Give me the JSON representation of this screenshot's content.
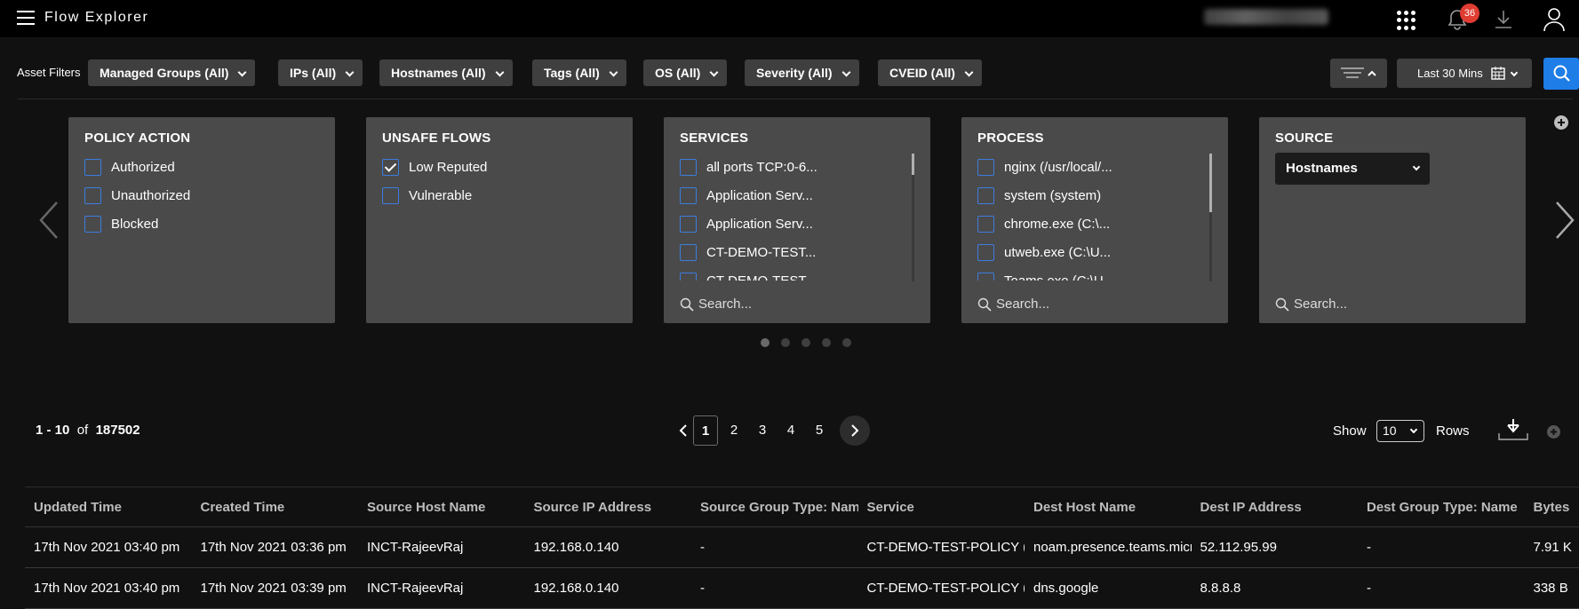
{
  "header": {
    "title": "Flow Explorer",
    "notification_count": "36",
    "icons": [
      "menu-icon",
      "apps-grid-icon",
      "bell-icon",
      "download-icon",
      "user-icon"
    ]
  },
  "filters": {
    "label": "Asset Filters",
    "chips": [
      "Managed Groups (All)",
      "IPs (All)",
      "Hostnames (All)",
      "Tags (All)",
      "OS (All)",
      "Severity (All)",
      "CVEID (All)"
    ],
    "time_range": "Last 30 Mins"
  },
  "cards": {
    "policy_action": {
      "title": "POLICY ACTION",
      "options": [
        {
          "label": "Authorized",
          "checked": false
        },
        {
          "label": "Unauthorized",
          "checked": false
        },
        {
          "label": "Blocked",
          "checked": false
        }
      ]
    },
    "unsafe_flows": {
      "title": "UNSAFE FLOWS",
      "options": [
        {
          "label": "Low Reputed",
          "checked": true
        },
        {
          "label": "Vulnerable",
          "checked": false
        }
      ]
    },
    "services": {
      "title": "SERVICES",
      "options": [
        "all ports TCP:0-6...",
        "Application Serv...",
        "Application Serv...",
        "CT-DEMO-TEST...",
        "CT-DEMO-TEST..."
      ],
      "search_placeholder": "Search..."
    },
    "process": {
      "title": "PROCESS",
      "options": [
        "nginx (/usr/local/...",
        "system (system)",
        "chrome.exe (C:\\...",
        "utweb.exe (C:\\U...",
        "Teams.exe (C:\\U..."
      ],
      "search_placeholder": "Search..."
    },
    "source": {
      "title": "SOURCE",
      "selected": "Hostnames",
      "search_placeholder": "Search..."
    }
  },
  "carousel": {
    "pages": 5,
    "active": 1
  },
  "pagination": {
    "range": "1 - 10",
    "of": "of",
    "total": "187502",
    "pages": [
      "1",
      "2",
      "3",
      "4",
      "5"
    ],
    "current": "1",
    "show_label": "Show",
    "rows_value": "10",
    "rows_label": "Rows"
  },
  "table": {
    "columns": [
      "Updated Time",
      "Created Time",
      "Source Host Name",
      "Source IP Address",
      "Source Group Type: Name",
      "Service",
      "Dest Host Name",
      "Dest IP Address",
      "Dest Group Type: Name",
      "Bytes"
    ],
    "rows": [
      [
        "17th Nov 2021 03:40 pm",
        "17th Nov 2021 03:36 pm",
        "INCT-RajeevRaj",
        "192.168.0.140",
        "-",
        "CT-DEMO-TEST-POLICY (",
        "noam.presence.teams.microsoft",
        "52.112.95.99",
        "-",
        "7.91 K"
      ],
      [
        "17th Nov 2021 03:40 pm",
        "17th Nov 2021 03:39 pm",
        "INCT-RajeevRaj",
        "192.168.0.140",
        "-",
        "CT-DEMO-TEST-POLICY (",
        "dns.google",
        "8.8.8.8",
        "-",
        "338 B"
      ]
    ]
  }
}
